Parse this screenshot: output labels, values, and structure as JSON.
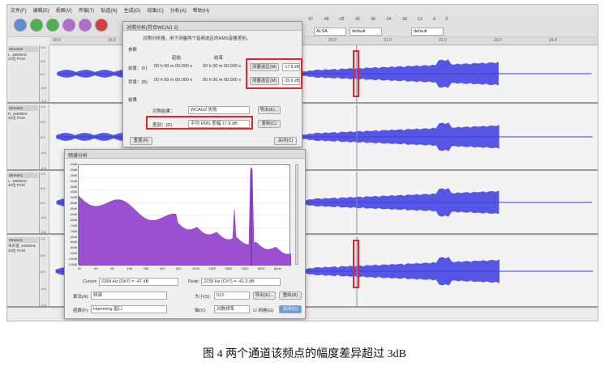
{
  "app": {
    "menu": [
      "文件(F)",
      "编辑(E)",
      "视图(V)",
      "传输(T)",
      "轨道(N)",
      "生成(G)",
      "效果(C)",
      "分析(A)",
      "帮助(H)"
    ],
    "meter_ticks": [
      "-57",
      "-48",
      "-42",
      "-36",
      "-30",
      "-24",
      "-18",
      "-12",
      "-6",
      "0"
    ],
    "host": "ALSA",
    "device_out": "default",
    "device_in": "default"
  },
  "ruler": {
    "ticks": [
      "15.0",
      "16.0",
      "17.0",
      "18.0",
      "19.0",
      "20.0",
      "21.0",
      "22.0",
      "23.0",
      "24.0"
    ]
  },
  "tracks": [
    {
      "name": "Stream0",
      "info": "L, 16000Hz",
      "fmt": "32位 PCM",
      "scale": [
        "1.0",
        "0.5",
        "0.0",
        "-0.5",
        "-1.0"
      ]
    },
    {
      "name": "Stream0",
      "info": "R, 16000Hz",
      "fmt": "32位 PCM",
      "scale": [
        "1.0",
        "0.5",
        "0.0",
        "-0.5",
        "-1.0"
      ]
    },
    {
      "name": "Stream1",
      "info": "L, 16000Hz",
      "fmt": "32位 PCM",
      "scale": [
        "1.0",
        "0.5",
        "0.0",
        "-0.5",
        "-1.0"
      ]
    },
    {
      "name": "Stream1",
      "info": "单声道, 16000Hz",
      "fmt": "32位 PCM",
      "scale": [
        "1.0",
        "0.5",
        "0.0",
        "-0.5",
        "-1.0"
      ]
    }
  ],
  "contrast_dialog": {
    "title": "对照分析(符合WCAG 2)",
    "intro": "对照分析器，用于测量两个音频选区的RMS音量差别。",
    "section_params": "参数",
    "row_fg": "前景：(F)",
    "row_bg": "背景：(B)",
    "col_start": "起始",
    "col_end": "结束",
    "time_placeholder": "00 h 00 m 00.000 s",
    "measure_fg": "测量选区(M)",
    "measure_bg": "测量选区(M)",
    "fg_value": "-17.8 dB",
    "bg_value": "-35.6 dB",
    "section_result": "结果",
    "pass_label": "对照结果：",
    "pass_value": "WCAG2 失败",
    "diff_label": "差别：(D)",
    "diff_value": "平均 RMS 差幅 17.8 dB",
    "export_button": "导出(E)...",
    "copy_button": "复制(C)",
    "reset_button": "重置(R)",
    "close_button": "关闭(C)"
  },
  "spectrum_dialog": {
    "title": "频谱分析",
    "y_ticks": [
      "-15dB",
      "-20dB",
      "-25dB",
      "-30dB",
      "-35dB",
      "-40dB",
      "-45dB",
      "-50dB",
      "-55dB",
      "-60dB",
      "-65dB",
      "-70dB",
      "-75dB",
      "-80dB",
      "-85dB",
      "-90dB",
      "-95dB",
      "-100dB",
      "-105dB"
    ],
    "x_ticks": [
      "40",
      "60",
      "90",
      "150",
      "250",
      "400",
      "600",
      "1000",
      "1500",
      "2500",
      "4000",
      "6000",
      "8kHz"
    ],
    "cursor_label": "Cursor:",
    "cursor_value": "2384 Hz (D#7) = -47 dB",
    "peak_label": "Peak:",
    "peak_value": "2239 Hz (C#7) = -41.2 dB",
    "algo_label": "算法(A):",
    "algo_value": "频谱",
    "size_label": "大小(S):",
    "size_value": "512",
    "export_button": "导出(E)...",
    "replot_button": "重绘(R)",
    "func_label": "函数(F):",
    "func_value": "Hamming 窗口",
    "axis_label": "轴(X):",
    "axis_value": "对数频率",
    "grid_label": "网格(G)",
    "close_button": "关闭(C)",
    "colors": {
      "fill": "#9b4fd1",
      "line": "#7a32b8"
    }
  },
  "caption": "图 4  两个通道该频点的幅度差异超过 3dB",
  "colors": {
    "wave": "#3a3ae0",
    "highlight": "#e0262a"
  }
}
